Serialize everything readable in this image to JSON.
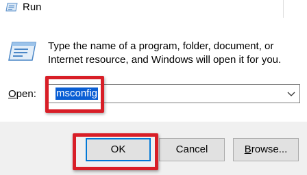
{
  "window": {
    "title": "Run"
  },
  "icons": {
    "title_icon": "run-icon",
    "dialog_icon": "run-icon",
    "dropdown_arrow": "chevron-down-icon"
  },
  "content": {
    "description": "Type the name of a program, folder, document, or Internet resource, and Windows will open it for you."
  },
  "open_field": {
    "label_mnemonic": "O",
    "label_rest": "pen:",
    "value": "msconfig"
  },
  "buttons": {
    "ok_label": "OK",
    "cancel_label": "Cancel",
    "browse_mnemonic": "B",
    "browse_rest": "rowse..."
  },
  "colors": {
    "highlight_box": "#d81e27",
    "selection": "#0a5ed4",
    "default_button_border": "#0078d7",
    "footer_background": "#f0f0f0"
  }
}
